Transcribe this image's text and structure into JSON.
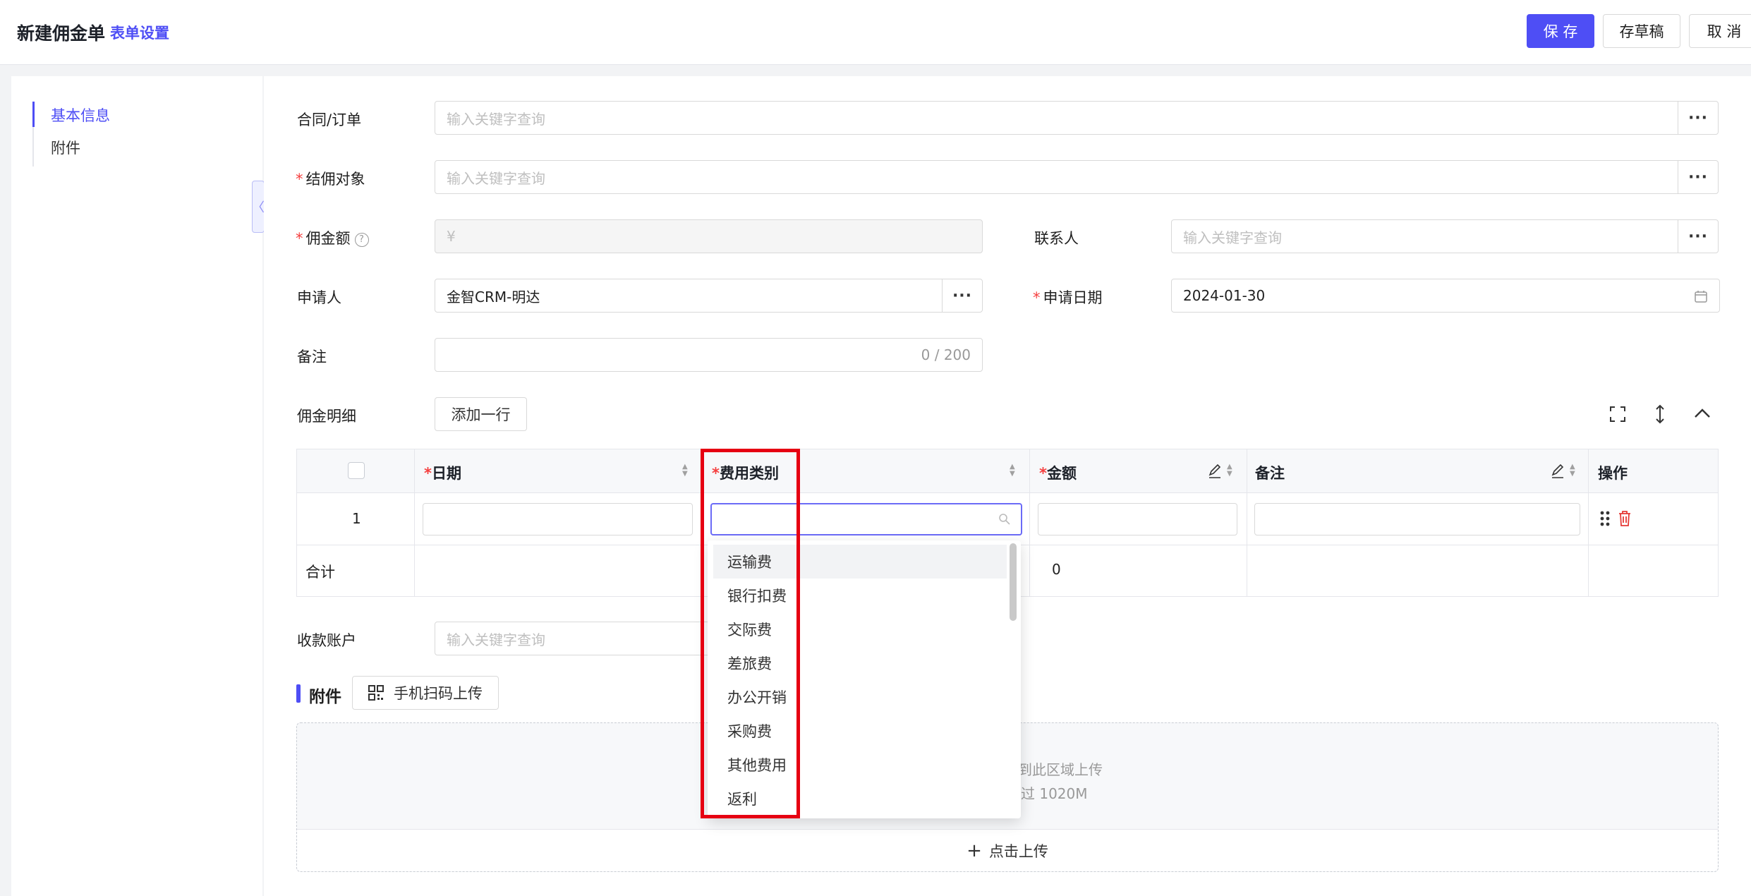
{
  "header": {
    "title": "新建佣金单",
    "form_settings": "表单设置",
    "save": "保 存",
    "draft": "存草稿",
    "cancel": "取 消"
  },
  "sidebar": {
    "items": [
      {
        "label": "基本信息",
        "active": true
      },
      {
        "label": "附件",
        "active": false
      }
    ]
  },
  "form": {
    "contract": {
      "label": "合同/订单",
      "placeholder": "输入关键字查询"
    },
    "settle_target": {
      "label": "结佣对象",
      "placeholder": "输入关键字查询"
    },
    "commission": {
      "label": "佣金额",
      "placeholder": "¥"
    },
    "contact": {
      "label": "联系人",
      "placeholder": "输入关键字查询"
    },
    "applicant": {
      "label": "申请人",
      "value": "金智CRM-明达"
    },
    "apply_date": {
      "label": "申请日期",
      "value": "2024-01-30"
    },
    "remark": {
      "label": "备注",
      "counter": "0 / 200"
    },
    "account": {
      "label": "收款账户",
      "placeholder": "输入关键字查询"
    }
  },
  "detail": {
    "label": "佣金明细",
    "add_row": "添加一行",
    "columns": [
      "日期",
      "费用类别",
      "金额",
      "备注",
      "操作"
    ],
    "rows": [
      {
        "index": "1"
      }
    ],
    "total_label": "合计",
    "total_amount": "0"
  },
  "dropdown": {
    "options": [
      "运输费",
      "银行扣费",
      "交际费",
      "差旅费",
      "办公开销",
      "采购费",
      "其他费用",
      "返利"
    ]
  },
  "attachments": {
    "title": "附件",
    "scan_upload": "手机扫码上传",
    "drop_hint": "到此区域上传",
    "size_hint": "过 1020M",
    "click_upload": "点击上传"
  },
  "colors": {
    "accent": "#4e4ef5",
    "required": "#f53f3f",
    "highlight": "#e60012"
  }
}
